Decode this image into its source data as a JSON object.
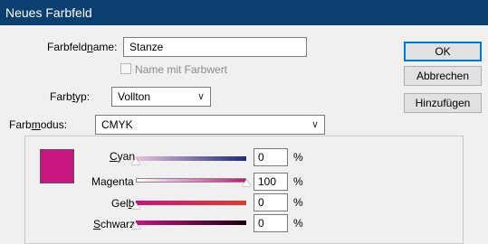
{
  "window": {
    "title": "Neues Farbfeld"
  },
  "form": {
    "name_label_pre": "Farbfeld",
    "name_label_u": "n",
    "name_label_post": "ame:",
    "name_value": "Stanze",
    "name_with_color_label": "Name mit Farbwert",
    "type_label_pre": "Farb",
    "type_label_u": "t",
    "type_label_post": "yp:",
    "type_value": "Vollton",
    "mode_label_pre": "Farb",
    "mode_label_u": "m",
    "mode_label_post": "odus:",
    "mode_value": "CMYK"
  },
  "buttons": {
    "ok": "OK",
    "cancel": "Abbrechen",
    "add": "Hinzufügen"
  },
  "swatch_color": "#c8157f",
  "channels": [
    {
      "pre": "",
      "u": "C",
      "post": "yan",
      "value": "0",
      "unit": "%",
      "gradient": [
        "#e6c3da",
        "#1e2b7a"
      ],
      "level": 0
    },
    {
      "pre": "Ma",
      "u": "g",
      "post": "enta",
      "value": "100",
      "unit": "%",
      "gradient": [
        "#ffffff",
        "#c8157f"
      ],
      "level": 100
    },
    {
      "pre": "Gel",
      "u": "b",
      "post": "",
      "value": "0",
      "unit": "%",
      "gradient": [
        "#c8157f",
        "#e23a2b"
      ],
      "level": 0
    },
    {
      "pre": "",
      "u": "S",
      "post": "chwarz",
      "value": "0",
      "unit": "%",
      "gradient": [
        "#c8157f",
        "#1a0010"
      ],
      "level": 0
    }
  ]
}
